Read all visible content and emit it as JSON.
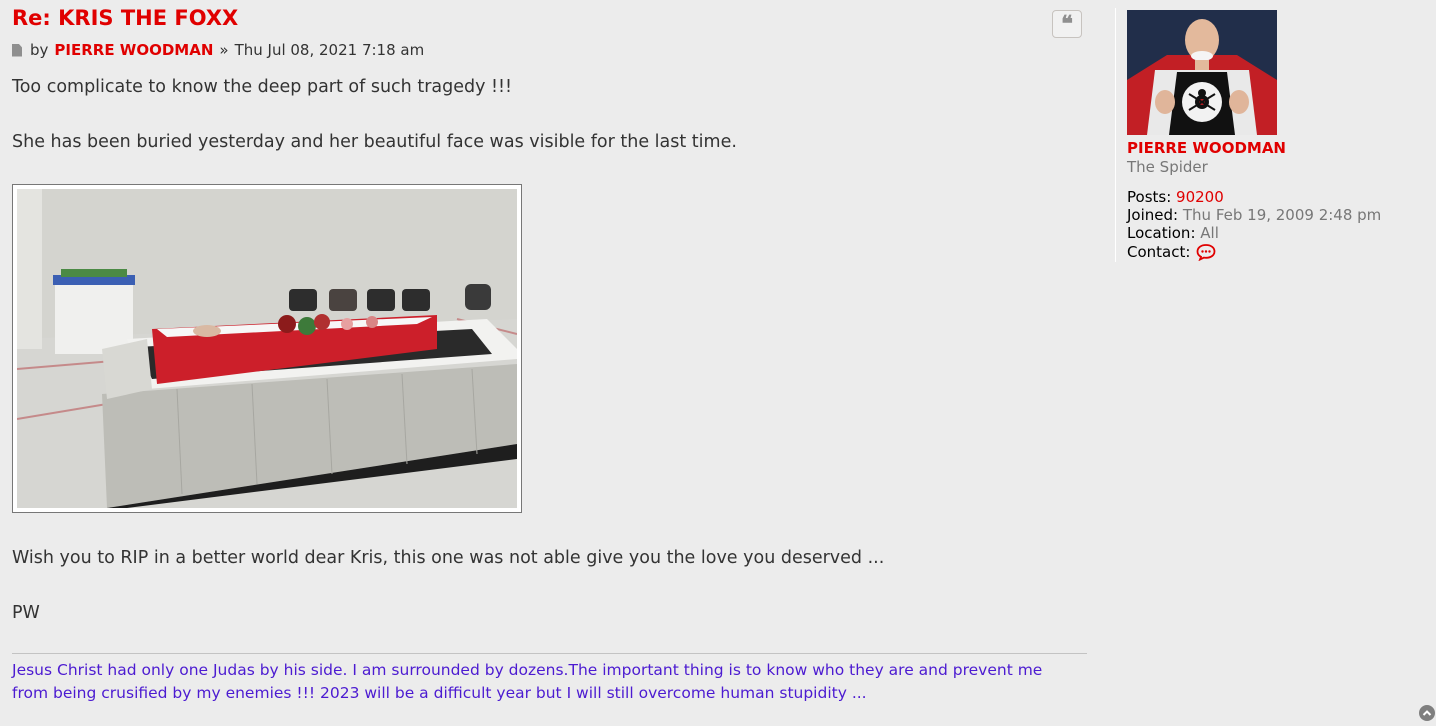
{
  "post": {
    "title": "Re: KRIS THE FOXX",
    "by_label": "by",
    "author": "PIERRE WOODMAN",
    "separator": "»",
    "datetime": "Thu Jul 08, 2021 7:18 am",
    "quote_icon": "quote-icon",
    "body": {
      "line1": "Too complicate to know the deep part of such tragedy !!!",
      "line2": "She has been buried yesterday and her beautiful face was visible for the last time.",
      "line3": "Wish you to RIP in a better world dear Kris, this one was not able give you the love you deserved ...",
      "line4": "PW"
    },
    "signature": "Jesus Christ had only one Judas by his side. I am surrounded by dozens.The important thing is to know who they are and prevent me from being crusified by my enemies !!! 2023 will be a difficult year but I will still overcome human stupidity ..."
  },
  "profile": {
    "username": "PIERRE WOODMAN",
    "rank": "The Spider",
    "posts_label": "Posts:",
    "posts_value": "90200",
    "joined_label": "Joined:",
    "joined_value": "Thu Feb 19, 2009 2:48 pm",
    "location_label": "Location:",
    "location_value": "All",
    "contact_label": "Contact:",
    "contact_icon": "chat-bubble-icon"
  },
  "colors": {
    "title": "#e00000",
    "author": "#e00000",
    "signature": "#4c1bd1",
    "background": "#ececec"
  }
}
